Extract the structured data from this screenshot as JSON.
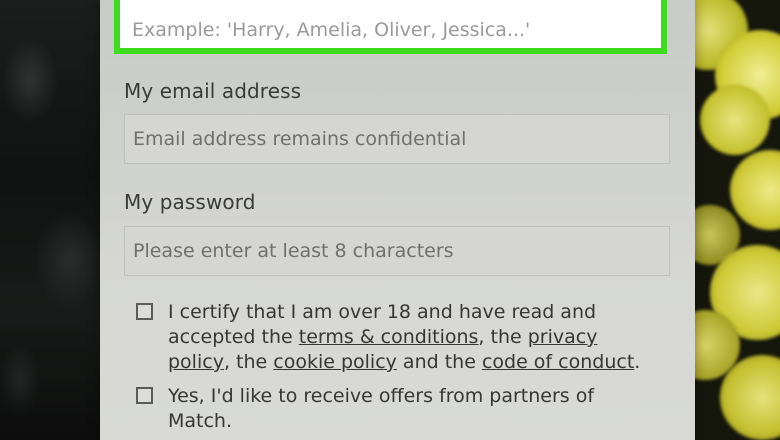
{
  "form": {
    "name_placeholder": "Example: 'Harry, Amelia, Oliver, Jessica...'",
    "email_label": "My email address",
    "email_placeholder": "Email address remains confidential",
    "password_label": "My password",
    "password_placeholder": "Please enter at least 8 characters",
    "certify": {
      "part1": "I certify that I am over 18 and have read and accepted the ",
      "terms_link": "terms & conditions",
      "part2": ", the ",
      "privacy_link": "privacy policy",
      "part3": ", the ",
      "cookie_link": "cookie policy",
      "part4": " and the ",
      "conduct_link": "code of conduct",
      "part5": "."
    },
    "offers_label": "Yes, I'd like to receive offers from partners of Match."
  },
  "colors": {
    "highlight_border": "#3fdb1f",
    "panel": "#d2d3cf"
  }
}
